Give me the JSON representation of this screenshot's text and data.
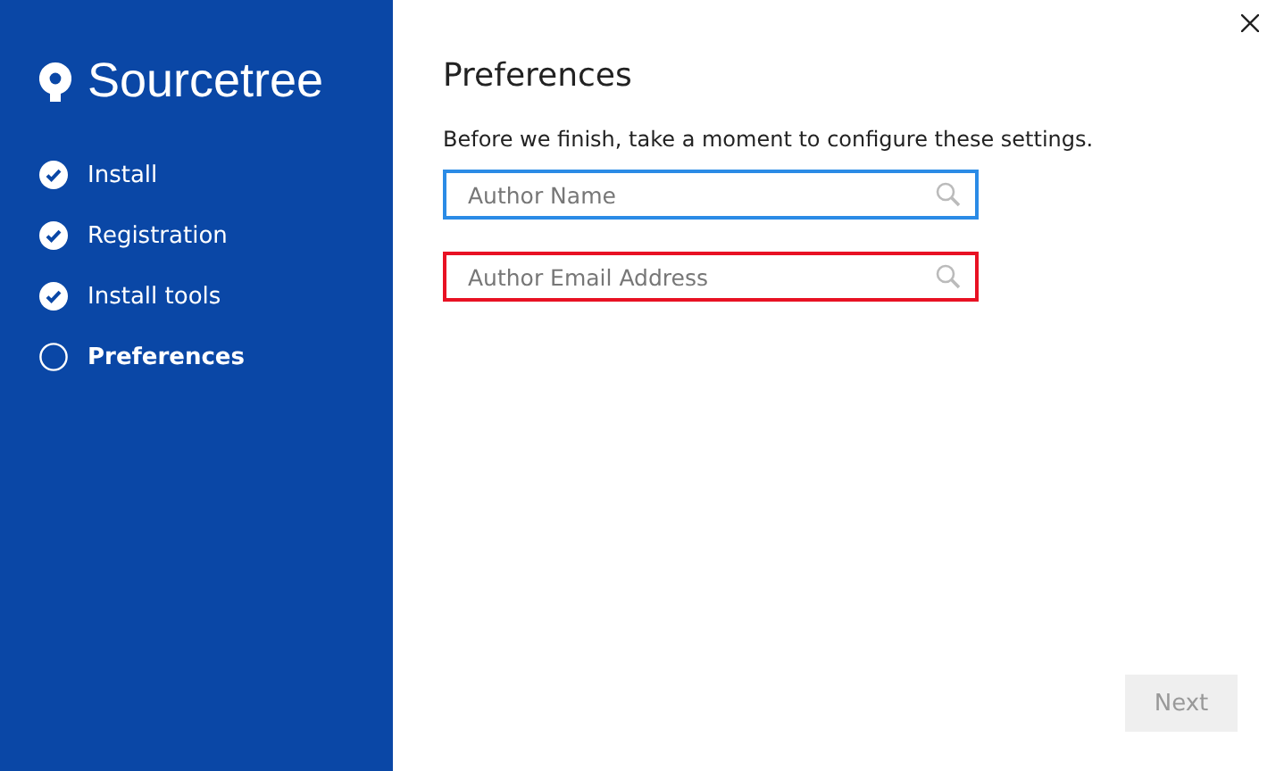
{
  "sidebar": {
    "app_name": "Sourcetree",
    "steps": [
      {
        "label": "Install",
        "done": true,
        "selected": false
      },
      {
        "label": "Registration",
        "done": true,
        "selected": false
      },
      {
        "label": "Install tools",
        "done": true,
        "selected": false
      },
      {
        "label": "Preferences",
        "done": false,
        "selected": true
      }
    ]
  },
  "page": {
    "title": "Preferences",
    "description": "Before we finish, take a moment to configure these settings.",
    "fields": [
      {
        "placeholder": "Author Name",
        "focused": true,
        "invalid": false
      },
      {
        "placeholder": "Author Email Address",
        "focused": false,
        "invalid": true
      }
    ],
    "next_button": {
      "label": "Next",
      "disabled": true
    }
  }
}
